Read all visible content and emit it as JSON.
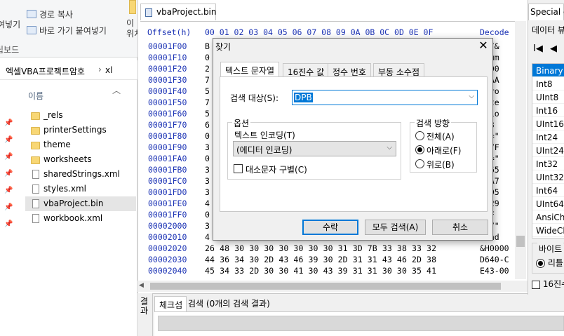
{
  "explorer": {
    "ribbon": {
      "paste_partial": "여넣기",
      "copy_path": "경로 복사",
      "paste_shortcut": "바로 가기 붙여넣기",
      "clipboard_label": "립보드",
      "move_partial": "이\n위치"
    },
    "address_path": "엑셀VBA프로젝트암호",
    "address_sep": "›",
    "address_current": "xl",
    "column_name": "이름",
    "items": [
      {
        "name": "_rels",
        "type": "folder"
      },
      {
        "name": "printerSettings",
        "type": "folder"
      },
      {
        "name": "theme",
        "type": "folder"
      },
      {
        "name": "worksheets",
        "type": "folder"
      },
      {
        "name": "sharedStrings.xml",
        "type": "file"
      },
      {
        "name": "styles.xml",
        "type": "file"
      },
      {
        "name": "vbaProject.bin",
        "type": "file",
        "selected": true
      },
      {
        "name": "workbook.xml",
        "type": "file"
      }
    ]
  },
  "hex": {
    "tab_title": "vbaProject.bin",
    "header_offset": "Offset(h)",
    "header_bytes": "00 01 02 03 04 05 06 07 08 09 0A 0B 0C 0D 0E 0F",
    "header_decoded": "Decode",
    "rows": [
      {
        "offset": "00001F00",
        "bytes": "B",
        "decoded": "a./&"
      },
      {
        "offset": "00001F10",
        "bytes": "0",
        "decoded": "ocum"
      },
      {
        "offset": "00001F20",
        "bytes": "2",
        "decoded": "0000"
      },
      {
        "offset": "00001F30",
        "bytes": "7",
        "decoded": "AAAA"
      },
      {
        "offset": "00001F40",
        "bytes": "5",
        "decoded": "APro"
      },
      {
        "offset": "00001F50",
        "bytes": "7",
        "decoded": "onte"
      },
      {
        "offset": "00001F60",
        "bytes": "5",
        "decoded": "rsio"
      },
      {
        "offset": "00001F70",
        "bytes": "6",
        "decoded": "=\"3"
      },
      {
        "offset": "00001F80",
        "bytes": "0",
        "decoded": "MG=\""
      },
      {
        "offset": "00001F90",
        "bytes": "3",
        "decoded": "317F"
      },
      {
        "offset": "00001FA0",
        "bytes": "0",
        "decoded": "AA=\""
      },
      {
        "offset": "00001FB0",
        "bytes": "3",
        "decoded": "9265"
      },
      {
        "offset": "00001FC0",
        "bytes": "3",
        "decoded": "09A7"
      },
      {
        "offset": "00001FD0",
        "bytes": "3",
        "decoded": "BBD5"
      },
      {
        "offset": "00001FE0",
        "bytes": "4",
        "decoded": "7229"
      },
      {
        "offset": "00001FF0",
        "bytes": "0",
        "decoded": "=\"F"
      },
      {
        "offset": "00002000",
        "bytes": "3",
        "decoded": "BA7\""
      },
      {
        "offset": "00002010",
        "bytes": "4",
        "decoded": "rend"
      },
      {
        "offset": "00002020",
        "bytes": "26 48 30 30 30 30 30 30 30 31 3D 7B 33 38 33 32",
        "decoded": "&H0000"
      },
      {
        "offset": "00002030",
        "bytes": "44 36 34 30 2D 43 46 39 30 2D 31 31 43 46 2D 38",
        "decoded": "D640-C"
      },
      {
        "offset": "00002040",
        "bytes": "45 34 33 2D 30 30 41 30 43 39 31 31 30 30 35 41",
        "decoded": "E43-00"
      }
    ]
  },
  "right_panel": {
    "tab_title": "Special e",
    "data_viewer_label": "데이터 뷰",
    "nav_first": "I◀",
    "nav_prev": "◀",
    "data_types": [
      "Binary (",
      "Int8",
      "UInt8",
      "Int16",
      "UInt16",
      "Int24",
      "UInt24",
      "Int32",
      "UInt32",
      "Int64",
      "UInt64",
      "AnsiCha",
      "WideCh"
    ],
    "selected_type": "Binary (",
    "byte_order_label": "바이트",
    "byte_order_option": "리틀",
    "hex16_label": "16진수"
  },
  "results": {
    "side_label": "결과",
    "tab_checksum": "체크섬",
    "tab_search": "검색 (0개의 검색 결과)"
  },
  "find_dialog": {
    "title": "찾기",
    "close_glyph": "✕",
    "tabs": [
      "텍스트 문자열",
      "16진수 값",
      "정수 번호",
      "부동 소수점"
    ],
    "active_tab": "텍스트 문자열",
    "search_target_label": "검색 대상(S):",
    "search_target_value": "DPB",
    "options_label": "옵션",
    "encoding_label": "텍스트 인코딩(T)",
    "encoding_value": "(에디터 인코딩)",
    "case_label": "대소문자 구별(C)",
    "direction_label": "검색 방향",
    "directions": [
      "전체(A)",
      "아래로(F)",
      "위로(B)"
    ],
    "selected_direction": "아래로(F)",
    "ok_label": "수락",
    "find_all_label": "모두 검색(A)",
    "cancel_label": "취소",
    "dropdown_glyph": "⌵"
  }
}
